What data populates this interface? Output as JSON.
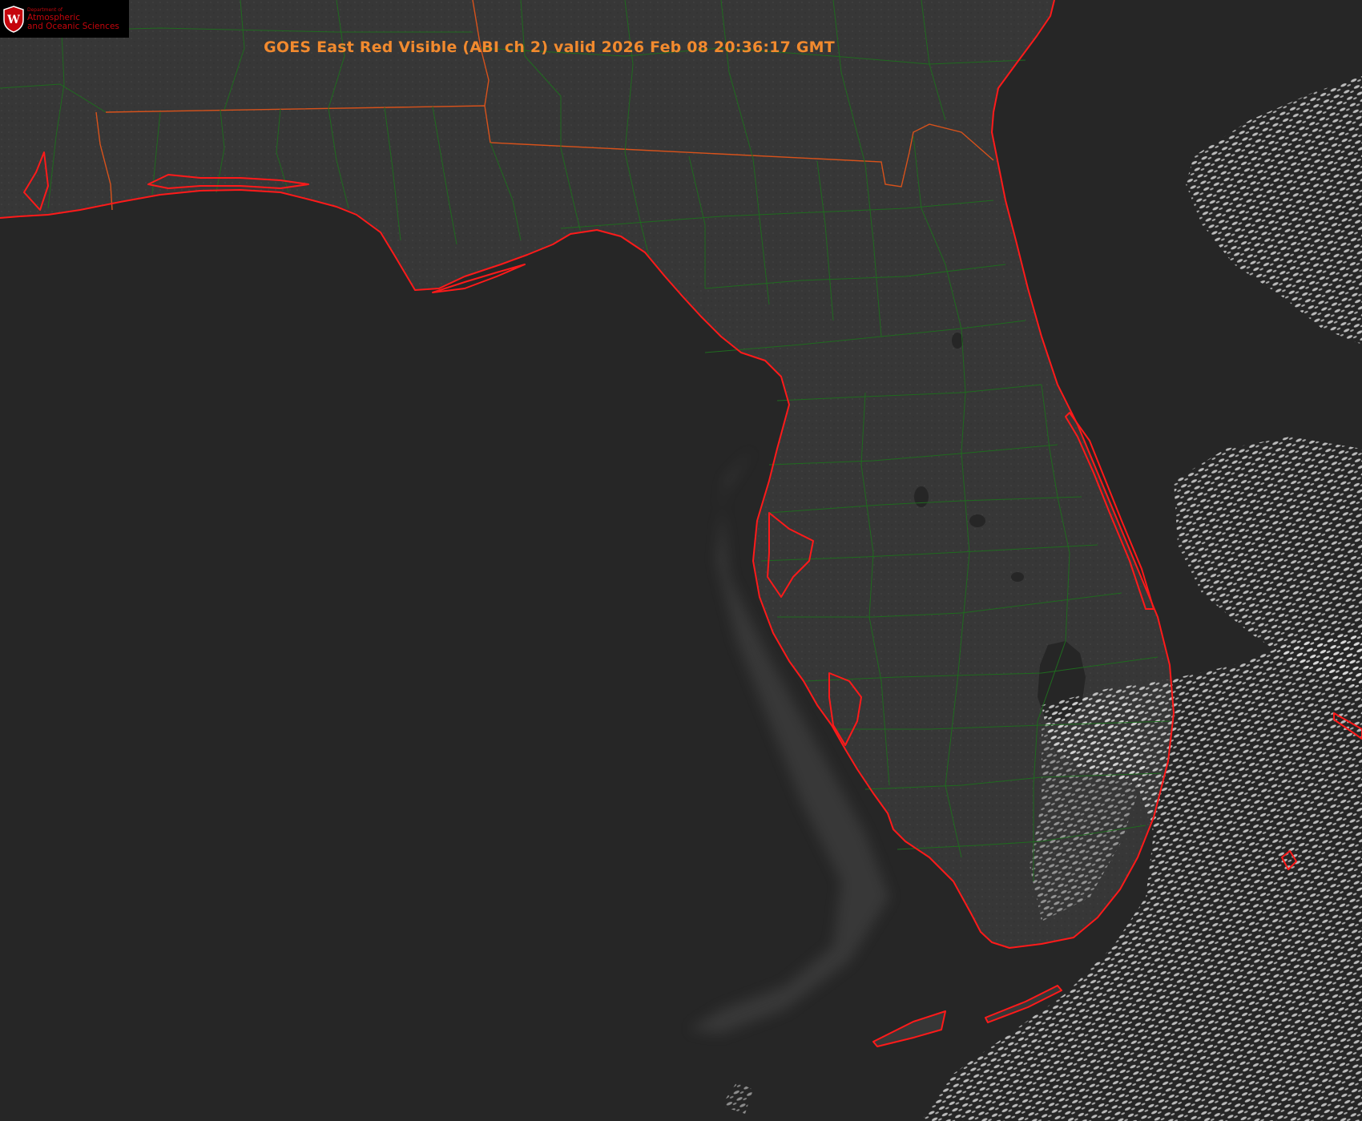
{
  "title": "GOES East Red Visible (ABI ch 2) valid 2026 Feb 08 20:36:17 GMT",
  "logo": {
    "department": "Department of",
    "line1": "Atmospheric",
    "line2": "and Oceanic Sciences",
    "shield_letter": "W",
    "icon": "uw-crest-icon"
  },
  "colors": {
    "water": "#262626",
    "land": "#373737",
    "coast": "#ff1a1a",
    "county": "#1f6b1f",
    "state": "#d8521b",
    "cloud": "#d4d4d4",
    "title": "#f28a2e"
  }
}
